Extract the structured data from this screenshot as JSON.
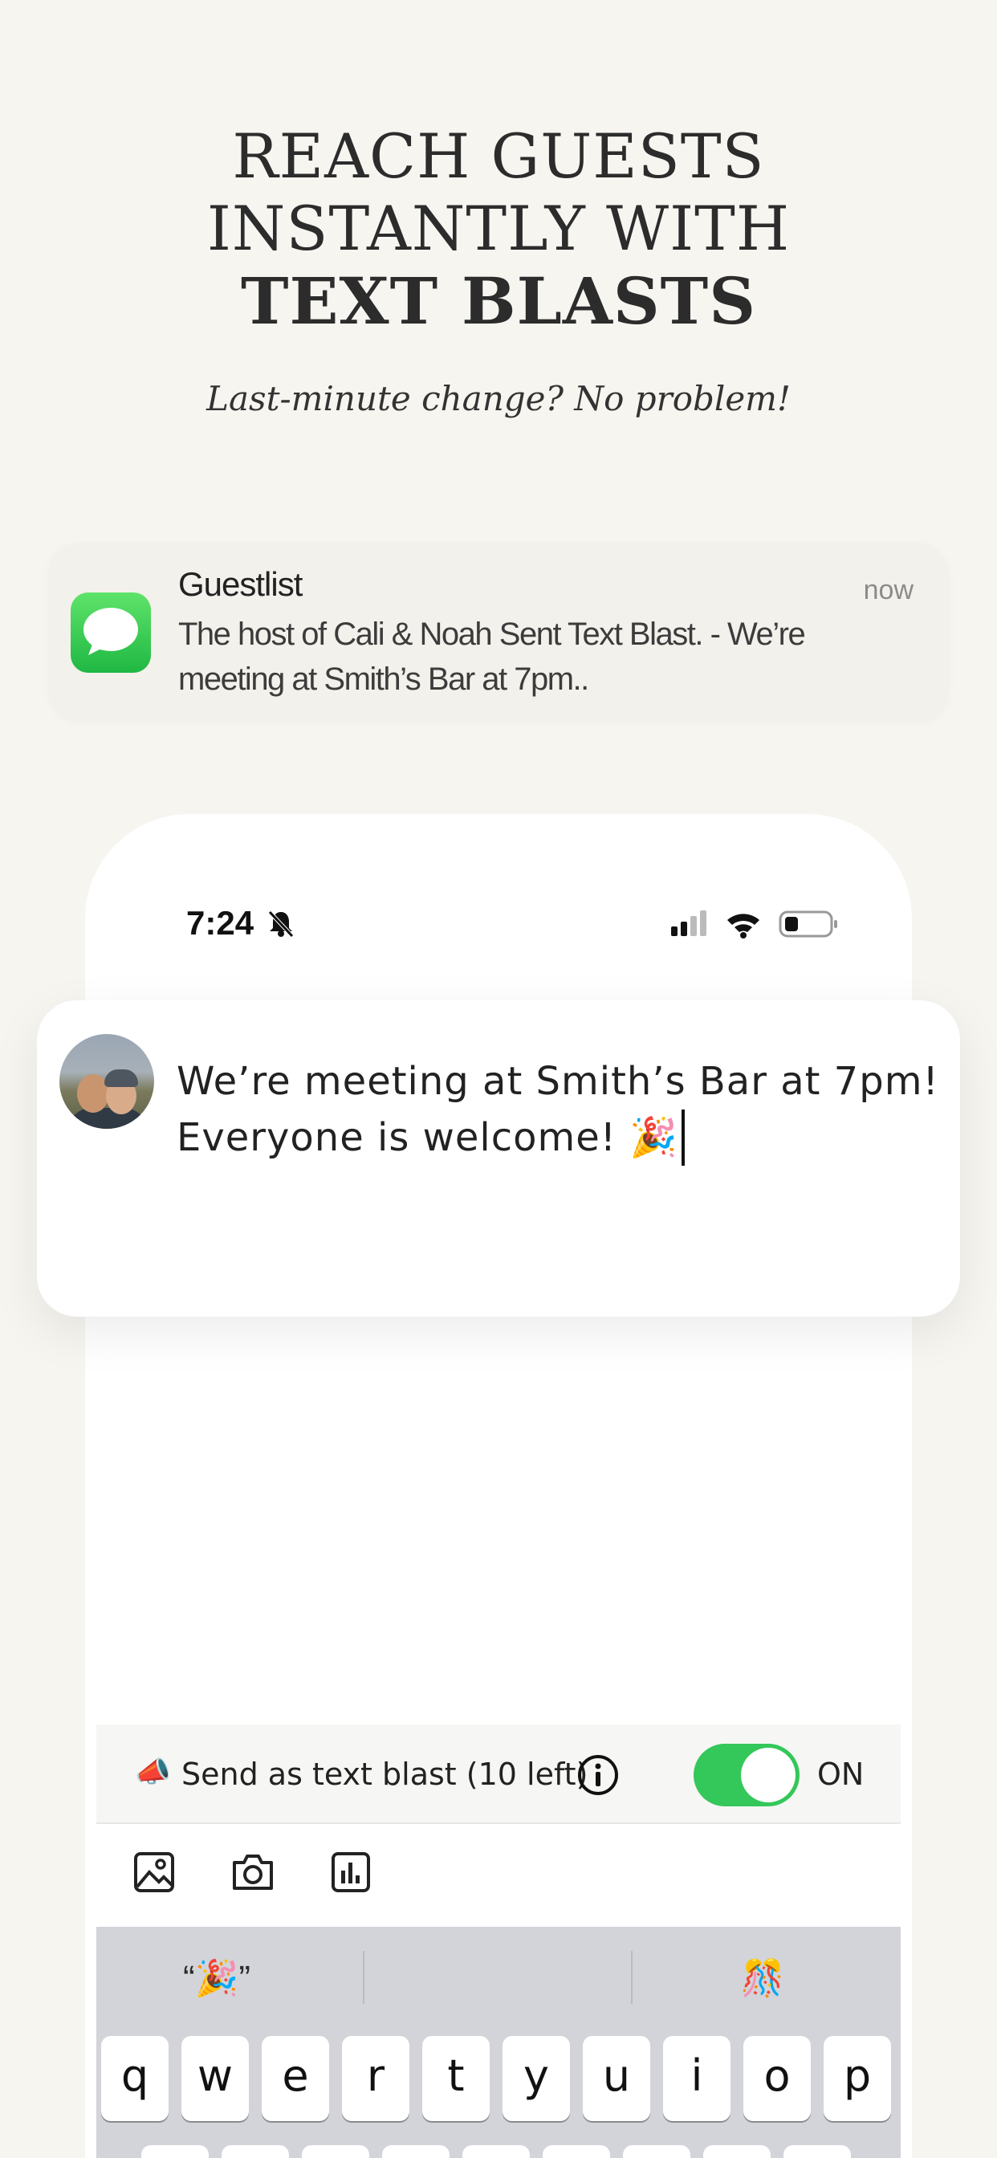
{
  "hero": {
    "line1": "REACH GUESTS",
    "line2": "INSTANTLY WITH",
    "line3": "TEXT BLASTS",
    "subtitle": "Last-minute change? No problem!"
  },
  "notification": {
    "app": "Guestlist",
    "time": "now",
    "body": "The host of Cali &  Noah Sent Text Blast. - We’re meeting at Smith’s Bar at 7pm..",
    "icon": "messages-icon"
  },
  "status_bar": {
    "time": "7:24",
    "icons": [
      "bell-slash-icon",
      "signal-icon",
      "wifi-icon",
      "battery-icon"
    ]
  },
  "message": {
    "text": "We’re meeting at Smith’s Bar at 7pm! Everyone is welcome! 🎉"
  },
  "blast": {
    "emoji": "📣",
    "label": "Send as text blast (10 left)",
    "toggle_label": "ON",
    "toggle_on": true,
    "accent": "#34c759"
  },
  "keyboard": {
    "suggestions": [
      "“🎉”",
      "",
      "🎊"
    ],
    "row1": [
      "q",
      "w",
      "e",
      "r",
      "t",
      "y",
      "u",
      "i",
      "o",
      "p"
    ]
  }
}
